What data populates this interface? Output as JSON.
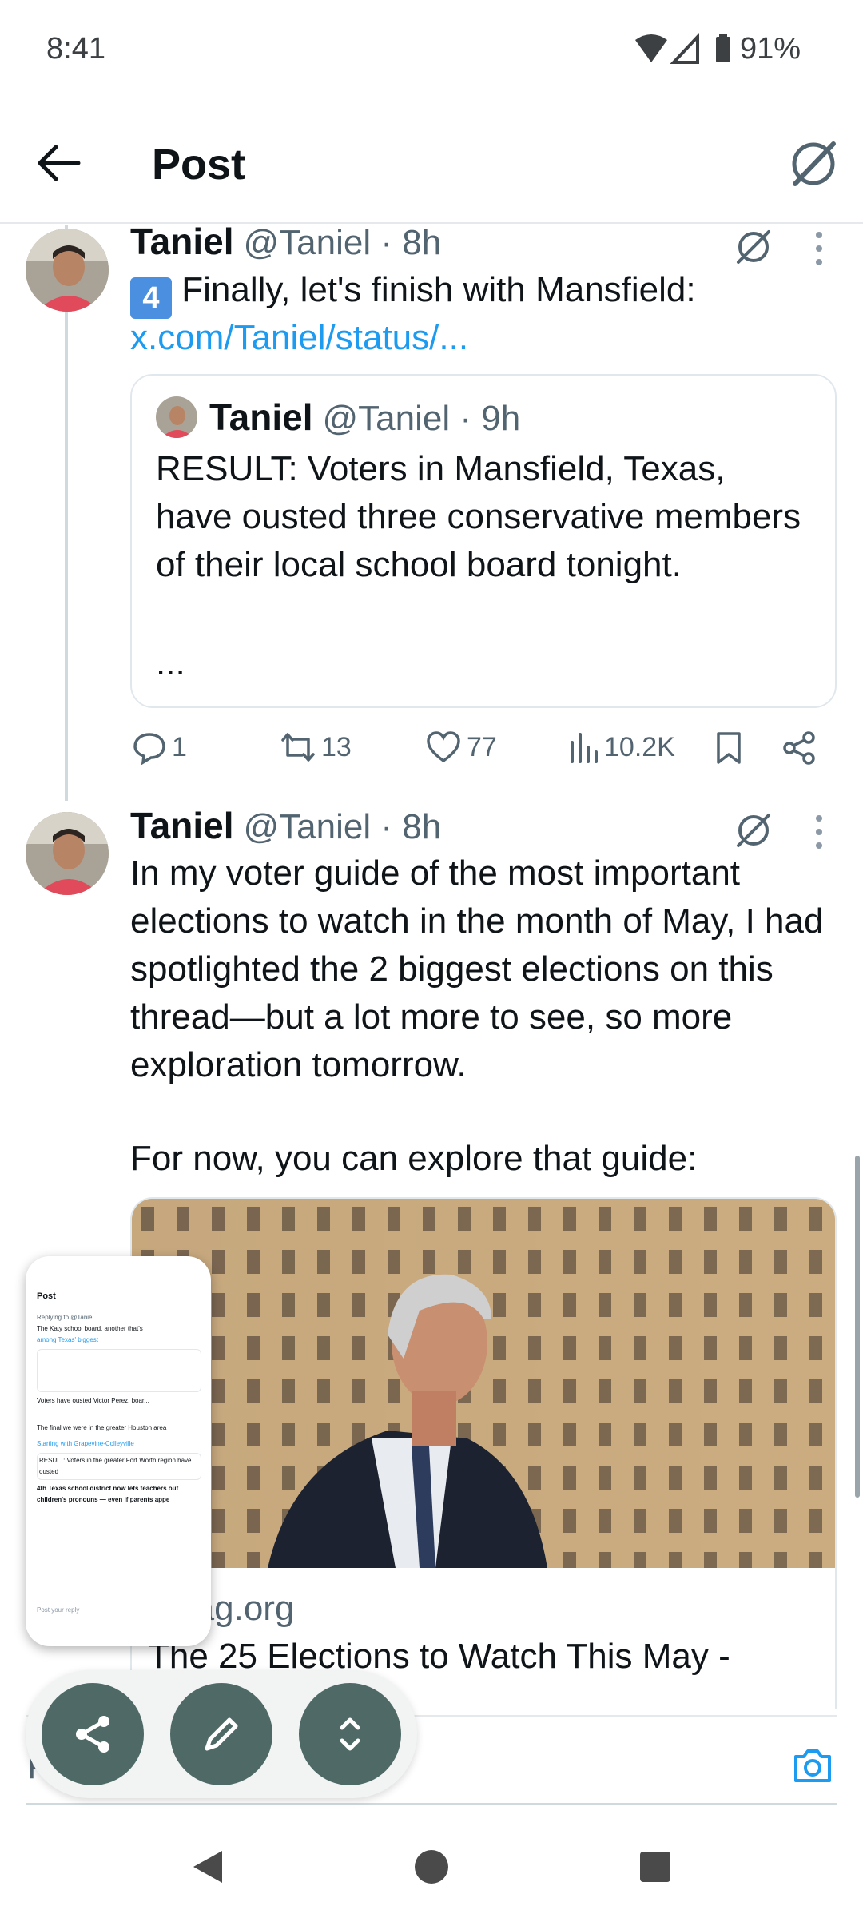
{
  "status_bar": {
    "time": "8:41",
    "battery": "91%"
  },
  "header": {
    "title": "Post"
  },
  "tweets": [
    {
      "name": "Taniel",
      "handle": "@Taniel · 8h",
      "text": "Finally, let's finish with Mansfield:",
      "badge": "4️⃣",
      "link": "x.com/Taniel/status/...",
      "quote": {
        "name": "Taniel",
        "handle": "@Taniel · 9h",
        "text": "RESULT: Voters in Mansfield, Texas, have ousted three conservative members of their local school board tonight.",
        "more": "..."
      },
      "stats": {
        "replies": "1",
        "reposts": "13",
        "likes": "77",
        "views": "10.2K"
      }
    },
    {
      "name": "Taniel",
      "handle": "@Taniel · 8h",
      "text": "In my voter guide of the most important elections to watch in the month of May, I had spotlighted the 2 biggest elections on this thread—but a lot more to see, so more exploration tomorrow.",
      "text2": "For now, you can explore that guide:",
      "card": {
        "domain": "smag.org",
        "title": "The 25 Elections to Watch This May -"
      }
    }
  ],
  "preview_thumbnail": {
    "title": "Post",
    "lines": [
      "Replying to @Taniel",
      "The Katy school board, another that's",
      "among Texas' biggest",
      "Voters have ousted Victor Perez, boar...",
      "The final we were in the greater Houston area",
      "Starting with Grapevine-Colleyville",
      "RESULT: Voters in the greater Fort Worth region have ousted",
      "4th Texas school district now lets teachers out children's pronouns — even if parents appe",
      "Post your reply"
    ]
  },
  "reply_bar": {
    "placeholder": "P"
  },
  "colors": {
    "link": "#1d9bf0",
    "fab": "#4f6a66",
    "muted": "#536471"
  }
}
